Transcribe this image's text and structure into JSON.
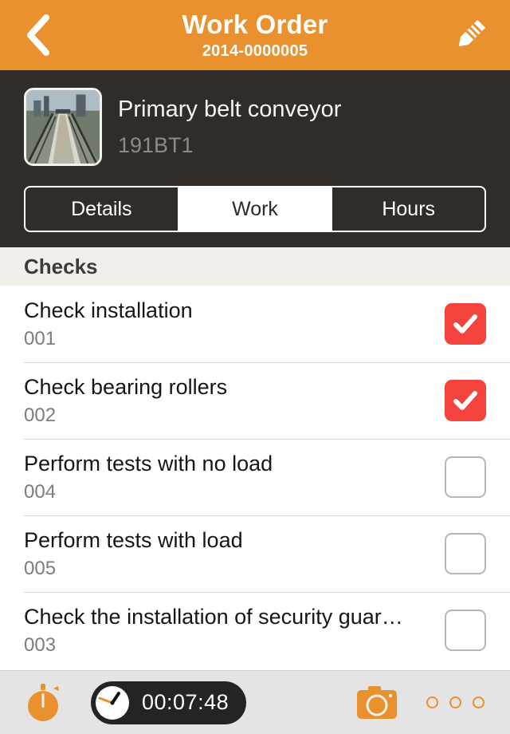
{
  "navbar": {
    "back_icon": "chevron-left-icon",
    "title": "Work Order",
    "subtitle": "2014-0000005",
    "edit_icon": "pencil-icon",
    "background_color": "#e8912e"
  },
  "asset": {
    "thumbnail_icon": "conveyor-photo-thumbnail",
    "name": "Primary belt conveyor",
    "code": "191BT1",
    "background_color": "#322c28"
  },
  "tabs": [
    {
      "label": "Details",
      "active": false
    },
    {
      "label": "Work",
      "active": true
    },
    {
      "label": "Hours",
      "active": false
    }
  ],
  "section": {
    "title": "Checks"
  },
  "checks": [
    {
      "title": "Check installation",
      "code": "001",
      "checked": true
    },
    {
      "title": "Check bearing rollers",
      "code": "002",
      "checked": true
    },
    {
      "title": "Perform tests with no load",
      "code": "004",
      "checked": false
    },
    {
      "title": "Perform tests with load",
      "code": "005",
      "checked": false
    },
    {
      "title": "Check the installation of security guar…",
      "code": "003",
      "checked": false
    }
  ],
  "toolbar": {
    "stopwatch_icon": "stopwatch-icon",
    "timer_clock_icon": "clock-icon",
    "timer_value": "00:07:48",
    "camera_icon": "camera-icon",
    "more_icon": "more-dots-icon",
    "accent_color": "#e8912e",
    "background_color": "#e4e4e4"
  },
  "colors": {
    "checked_checkbox": "#f4433c",
    "unchecked_border": "#b6b6b6",
    "section_header_bg": "#f2efea"
  }
}
